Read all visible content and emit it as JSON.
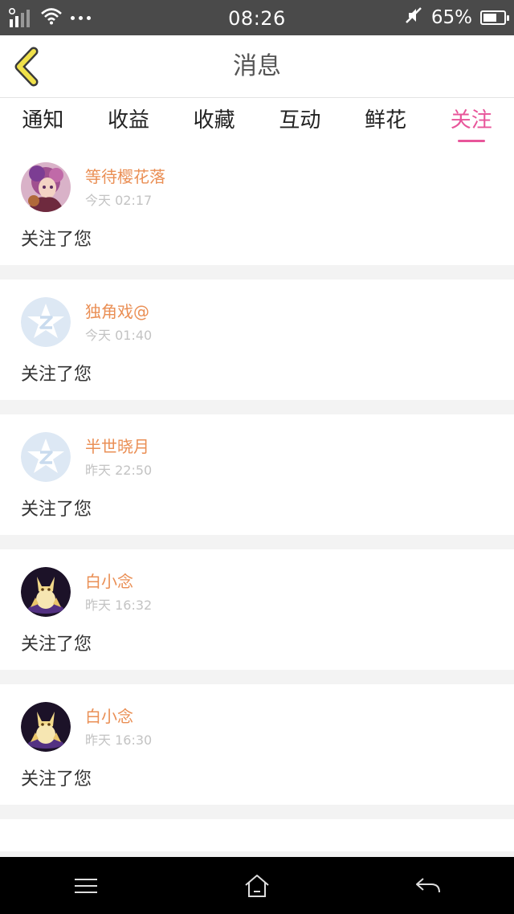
{
  "status_bar": {
    "time": "08:26",
    "battery_text": "65%",
    "battery_level": 0.65,
    "icons": [
      "signal-icon",
      "wifi-icon",
      "more-dots-icon",
      "mute-icon",
      "battery-icon"
    ]
  },
  "header": {
    "title": "消息",
    "back_icon": "back-chevron-icon"
  },
  "tabs": [
    {
      "label": "通知",
      "active": false
    },
    {
      "label": "收益",
      "active": false
    },
    {
      "label": "收藏",
      "active": false
    },
    {
      "label": "互动",
      "active": false
    },
    {
      "label": "鲜花",
      "active": false
    },
    {
      "label": "关注",
      "active": true
    }
  ],
  "colors": {
    "accent": "#e8559a",
    "name": "#ea8f55",
    "timestamp": "#c3c3c3",
    "back_icon": "#f0e14a"
  },
  "notifications": [
    {
      "name": "等待樱花落",
      "time": "今天 02:17",
      "message": "关注了您",
      "avatar": "anime-girl-avatar"
    },
    {
      "name": "独角戏@",
      "time": "今天 01:40",
      "message": "关注了您",
      "avatar": "default-star-avatar"
    },
    {
      "name": "半世晓月",
      "time": "昨天 22:50",
      "message": "关注了您",
      "avatar": "default-star-avatar"
    },
    {
      "name": "白小念",
      "time": "昨天 16:32",
      "message": "关注了您",
      "avatar": "gold-fox-avatar"
    },
    {
      "name": "白小念",
      "time": "昨天 16:30",
      "message": "关注了您",
      "avatar": "gold-fox-avatar"
    }
  ],
  "nav_bar": {
    "buttons": [
      "menu-icon",
      "home-icon",
      "back-arrow-icon"
    ]
  }
}
